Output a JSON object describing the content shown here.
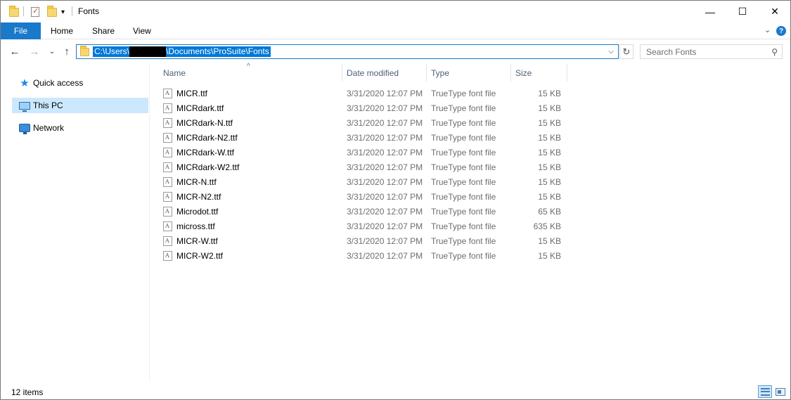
{
  "window": {
    "title": "Fonts",
    "minimize": "—",
    "maximize": "☐",
    "close": "✕"
  },
  "ribbon": {
    "tabs": [
      "File",
      "Home",
      "Share",
      "View"
    ],
    "expand": "⌄",
    "help": "?"
  },
  "address": {
    "path_start": "C:\\Users\\",
    "path_end": "\\Documents\\ProSuite\\Fonts",
    "dropdown": "⌵",
    "refresh": "↻"
  },
  "nav_buttons": {
    "back": "←",
    "forward": "→",
    "recent": "⌄",
    "up": "↑"
  },
  "search": {
    "placeholder": "Search Fonts",
    "icon": "⚲"
  },
  "navpane": {
    "items": [
      {
        "label": "Quick access",
        "icon": "star-icon"
      },
      {
        "label": "This PC",
        "icon": "this-pc-icon",
        "selected": true
      },
      {
        "label": "Network",
        "icon": "network-icon"
      }
    ]
  },
  "columns": {
    "name": "Name",
    "date": "Date modified",
    "type": "Type",
    "size": "Size",
    "sort_indicator": "^"
  },
  "files": [
    {
      "name": "MICR.ttf",
      "date": "3/31/2020 12:07 PM",
      "type": "TrueType font file",
      "size": "15 KB"
    },
    {
      "name": "MICRdark.ttf",
      "date": "3/31/2020 12:07 PM",
      "type": "TrueType font file",
      "size": "15 KB"
    },
    {
      "name": "MICRdark-N.ttf",
      "date": "3/31/2020 12:07 PM",
      "type": "TrueType font file",
      "size": "15 KB"
    },
    {
      "name": "MICRdark-N2.ttf",
      "date": "3/31/2020 12:07 PM",
      "type": "TrueType font file",
      "size": "15 KB"
    },
    {
      "name": "MICRdark-W.ttf",
      "date": "3/31/2020 12:07 PM",
      "type": "TrueType font file",
      "size": "15 KB"
    },
    {
      "name": "MICRdark-W2.ttf",
      "date": "3/31/2020 12:07 PM",
      "type": "TrueType font file",
      "size": "15 KB"
    },
    {
      "name": "MICR-N.ttf",
      "date": "3/31/2020 12:07 PM",
      "type": "TrueType font file",
      "size": "15 KB"
    },
    {
      "name": "MICR-N2.ttf",
      "date": "3/31/2020 12:07 PM",
      "type": "TrueType font file",
      "size": "15 KB"
    },
    {
      "name": "Microdot.ttf",
      "date": "3/31/2020 12:07 PM",
      "type": "TrueType font file",
      "size": "65 KB"
    },
    {
      "name": "micross.ttf",
      "date": "3/31/2020 12:07 PM",
      "type": "TrueType font file",
      "size": "635 KB"
    },
    {
      "name": "MICR-W.ttf",
      "date": "3/31/2020 12:07 PM",
      "type": "TrueType font file",
      "size": "15 KB"
    },
    {
      "name": "MICR-W2.ttf",
      "date": "3/31/2020 12:07 PM",
      "type": "TrueType font file",
      "size": "15 KB"
    }
  ],
  "status": {
    "items_count": "12 items"
  },
  "colors": {
    "accent": "#1979ca",
    "selection": "#0078d7",
    "nav_selected": "#cce8ff",
    "header_text": "#4c607a"
  }
}
